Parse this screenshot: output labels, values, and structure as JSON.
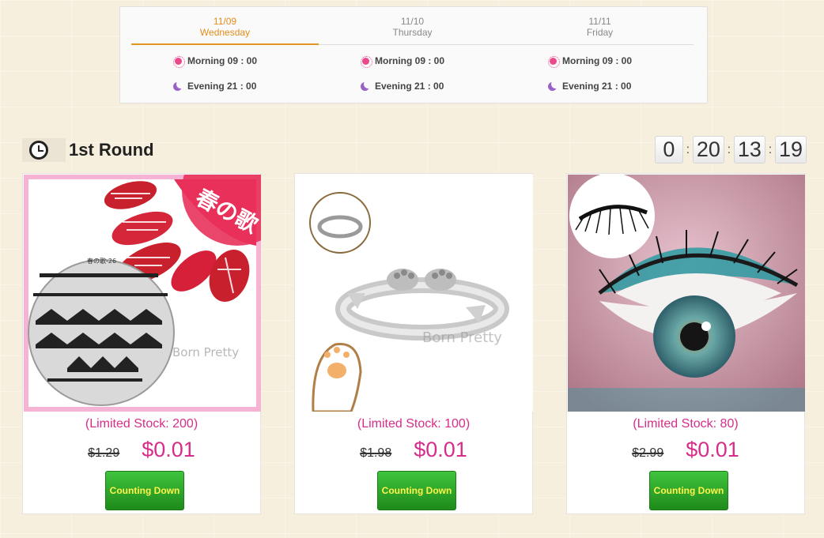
{
  "schedule": {
    "tabs": [
      {
        "date": "11/09",
        "day": "Wednesday"
      },
      {
        "date": "11/10",
        "day": "Thursday"
      },
      {
        "date": "11/11",
        "day": "Friday"
      }
    ],
    "morning_label": "Morning 09 : 00",
    "evening_label": "Evening 21 : 00"
  },
  "round": {
    "title": "1st Round",
    "countdown": [
      "0",
      "20",
      "13",
      "19"
    ],
    "separator": ":"
  },
  "products": [
    {
      "stock": "(Limited Stock: 200)",
      "old_price": "$1.29",
      "new_price": "$0.01",
      "button": "Counting Down",
      "image_text": "春の歌",
      "watermark": "Born Pretty",
      "plate_label": "春の歌-26"
    },
    {
      "stock": "(Limited Stock: 100)",
      "old_price": "$1.98",
      "new_price": "$0.01",
      "button": "Counting Down",
      "watermark": "Born Pretty"
    },
    {
      "stock": "(Limited Stock: 80)",
      "old_price": "$2.99",
      "new_price": "$0.01",
      "button": "Counting Down"
    }
  ],
  "colors": {
    "accent": "#e28d1a",
    "price": "#d62d8a",
    "button": "#2aa526"
  }
}
